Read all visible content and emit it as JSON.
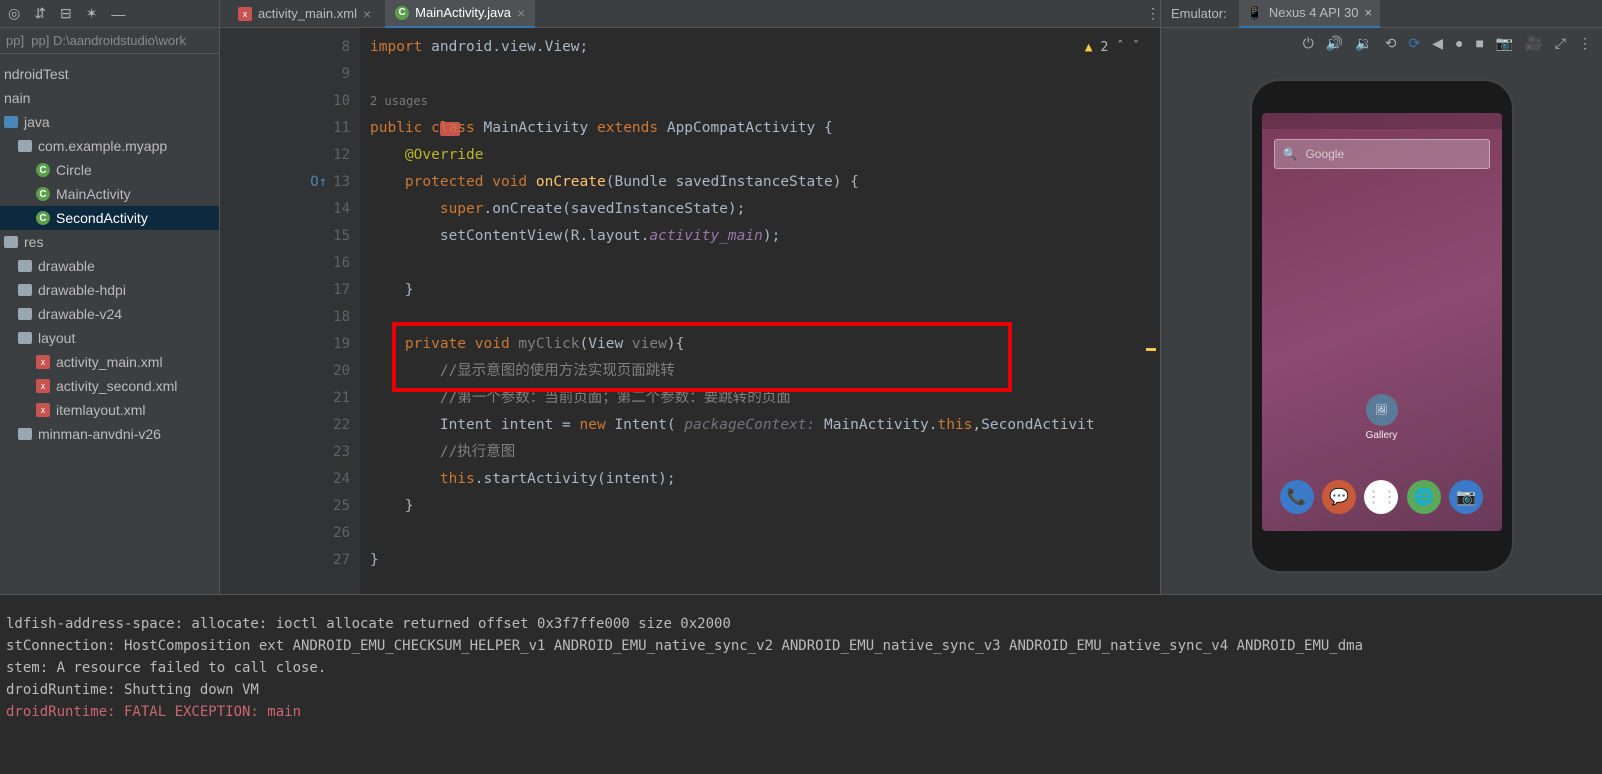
{
  "leftPath": "pp]  D:\\aandroidstudio\\work",
  "tree": {
    "androidTest": "ndroidTest",
    "main": "nain",
    "java": "java",
    "pkg": "com.example.myapp",
    "circle": "Circle",
    "mainActivity": "MainActivity",
    "secondActivity": "SecondActivity",
    "res": "res",
    "drawable": "drawable",
    "drawableHdpi": "drawable-hdpi",
    "drawableV24": "drawable-v24",
    "layout": "layout",
    "activityMain": "activity_main.xml",
    "activitySecond": "activity_second.xml",
    "itemlayout": "itemlayout.xml",
    "mipmap": "minman-anvdni-v26"
  },
  "tabs": {
    "xml": "activity_main.xml",
    "java": "MainActivity.java"
  },
  "warnings": {
    "count": "2"
  },
  "gutter": {
    "usages": "2 usages",
    "lines": [
      "8",
      "9",
      "10",
      "11",
      "12",
      "13",
      "14",
      "15",
      "16",
      "17",
      "18",
      "19",
      "20",
      "21",
      "22",
      "23",
      "24",
      "25",
      "26",
      "27"
    ]
  },
  "code": {
    "l8_import": "import",
    "l8_rest": " android.view.View;",
    "l11_public": "public ",
    "l11_class": "class ",
    "l11_name": "MainActivity ",
    "l11_extends": "extends ",
    "l11_sup": "AppCompatActivity {",
    "l12": "@Override",
    "l13_prot": "protected ",
    "l13_void": "void ",
    "l13_method": "onCreate",
    "l13_sig": "(Bundle savedInstanceState) {",
    "l14_super": "super",
    "l14_rest": ".onCreate(savedInstanceState);",
    "l15_a": "setContentView(R.layout.",
    "l15_b": "activity_main",
    "l15_c": ");",
    "l17": "}",
    "l19_priv": "private ",
    "l19_void": "void ",
    "l19_method": "myClick",
    "l19_p1": "(View ",
    "l19_p2": "view",
    "l19_p3": "){",
    "l20": "//显示意图的使用方法实现页面跳转",
    "l21": "//第一个参数：当前页面；第二个参数：要跳转的页面",
    "l22_a": "Intent intent = ",
    "l22_new": "new ",
    "l22_b": "Intent( ",
    "l22_hint": "packageContext: ",
    "l22_c": "MainActivity.",
    "l22_this": "this",
    "l22_d": ",SecondActivit",
    "l23": "//执行意图",
    "l24_this": "this",
    "l24_a": ".startActivity(intent);",
    "l25": "}",
    "l27": "}"
  },
  "emulator": {
    "label": "Emulator:",
    "device": "Nexus 4 API 30",
    "searchPlaceholder": "Google",
    "gallery": "Gallery"
  },
  "console": {
    "l1": "ldfish-address-space: allocate: ioctl allocate returned offset 0x3f7ffe000 size 0x2000",
    "l2": "stConnection: HostComposition ext ANDROID_EMU_CHECKSUM_HELPER_v1 ANDROID_EMU_native_sync_v2 ANDROID_EMU_native_sync_v3 ANDROID_EMU_native_sync_v4 ANDROID_EMU_dma",
    "l3": "stem: A resource failed to call close.",
    "l4": "droidRuntime: Shutting down VM",
    "l5": "droidRuntime: FATAL EXCEPTION: main"
  }
}
